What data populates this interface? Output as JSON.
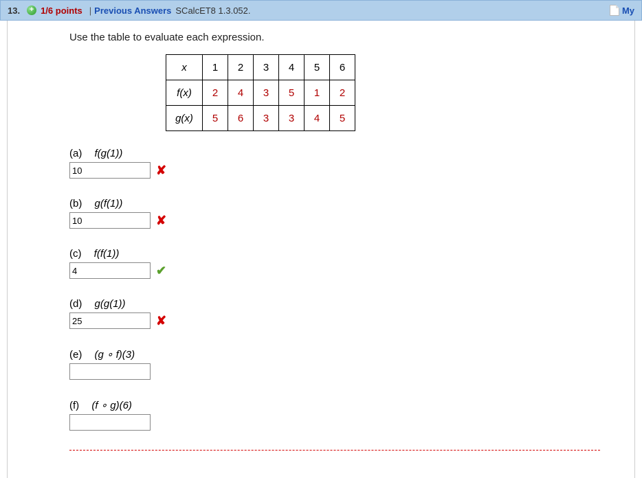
{
  "header": {
    "number": "13.",
    "plus": "+",
    "points": "1/6 points",
    "divider": "|",
    "previous": "Previous Answers",
    "source": "SCalcET8 1.3.052.",
    "my": "My"
  },
  "prompt": "Use the table to evaluate each expression.",
  "chart_data": {
    "type": "table",
    "title": "",
    "rows": [
      {
        "label": "x",
        "values": [
          1,
          2,
          3,
          4,
          5,
          6
        ],
        "value_color": "black"
      },
      {
        "label": "f(x)",
        "values": [
          2,
          4,
          3,
          5,
          1,
          2
        ],
        "value_color": "red"
      },
      {
        "label": "g(x)",
        "values": [
          5,
          6,
          3,
          3,
          4,
          5
        ],
        "value_color": "red"
      }
    ]
  },
  "parts": {
    "a": {
      "letter": "(a)",
      "expr": "f(g(1))",
      "value": "10",
      "mark": "wrong"
    },
    "b": {
      "letter": "(b)",
      "expr": "g(f(1))",
      "value": "10",
      "mark": "wrong"
    },
    "c": {
      "letter": "(c)",
      "expr": "f(f(1))",
      "value": "4",
      "mark": "correct"
    },
    "d": {
      "letter": "(d)",
      "expr": "g(g(1))",
      "value": "25",
      "mark": "wrong"
    },
    "e": {
      "letter": "(e)",
      "expr": "(g ∘ f)(3)",
      "value": "",
      "mark": ""
    },
    "f": {
      "letter": "(f)",
      "expr": "(f ∘ g)(6)",
      "value": "",
      "mark": ""
    }
  },
  "marks": {
    "wrong": "✘",
    "correct": "✔"
  }
}
